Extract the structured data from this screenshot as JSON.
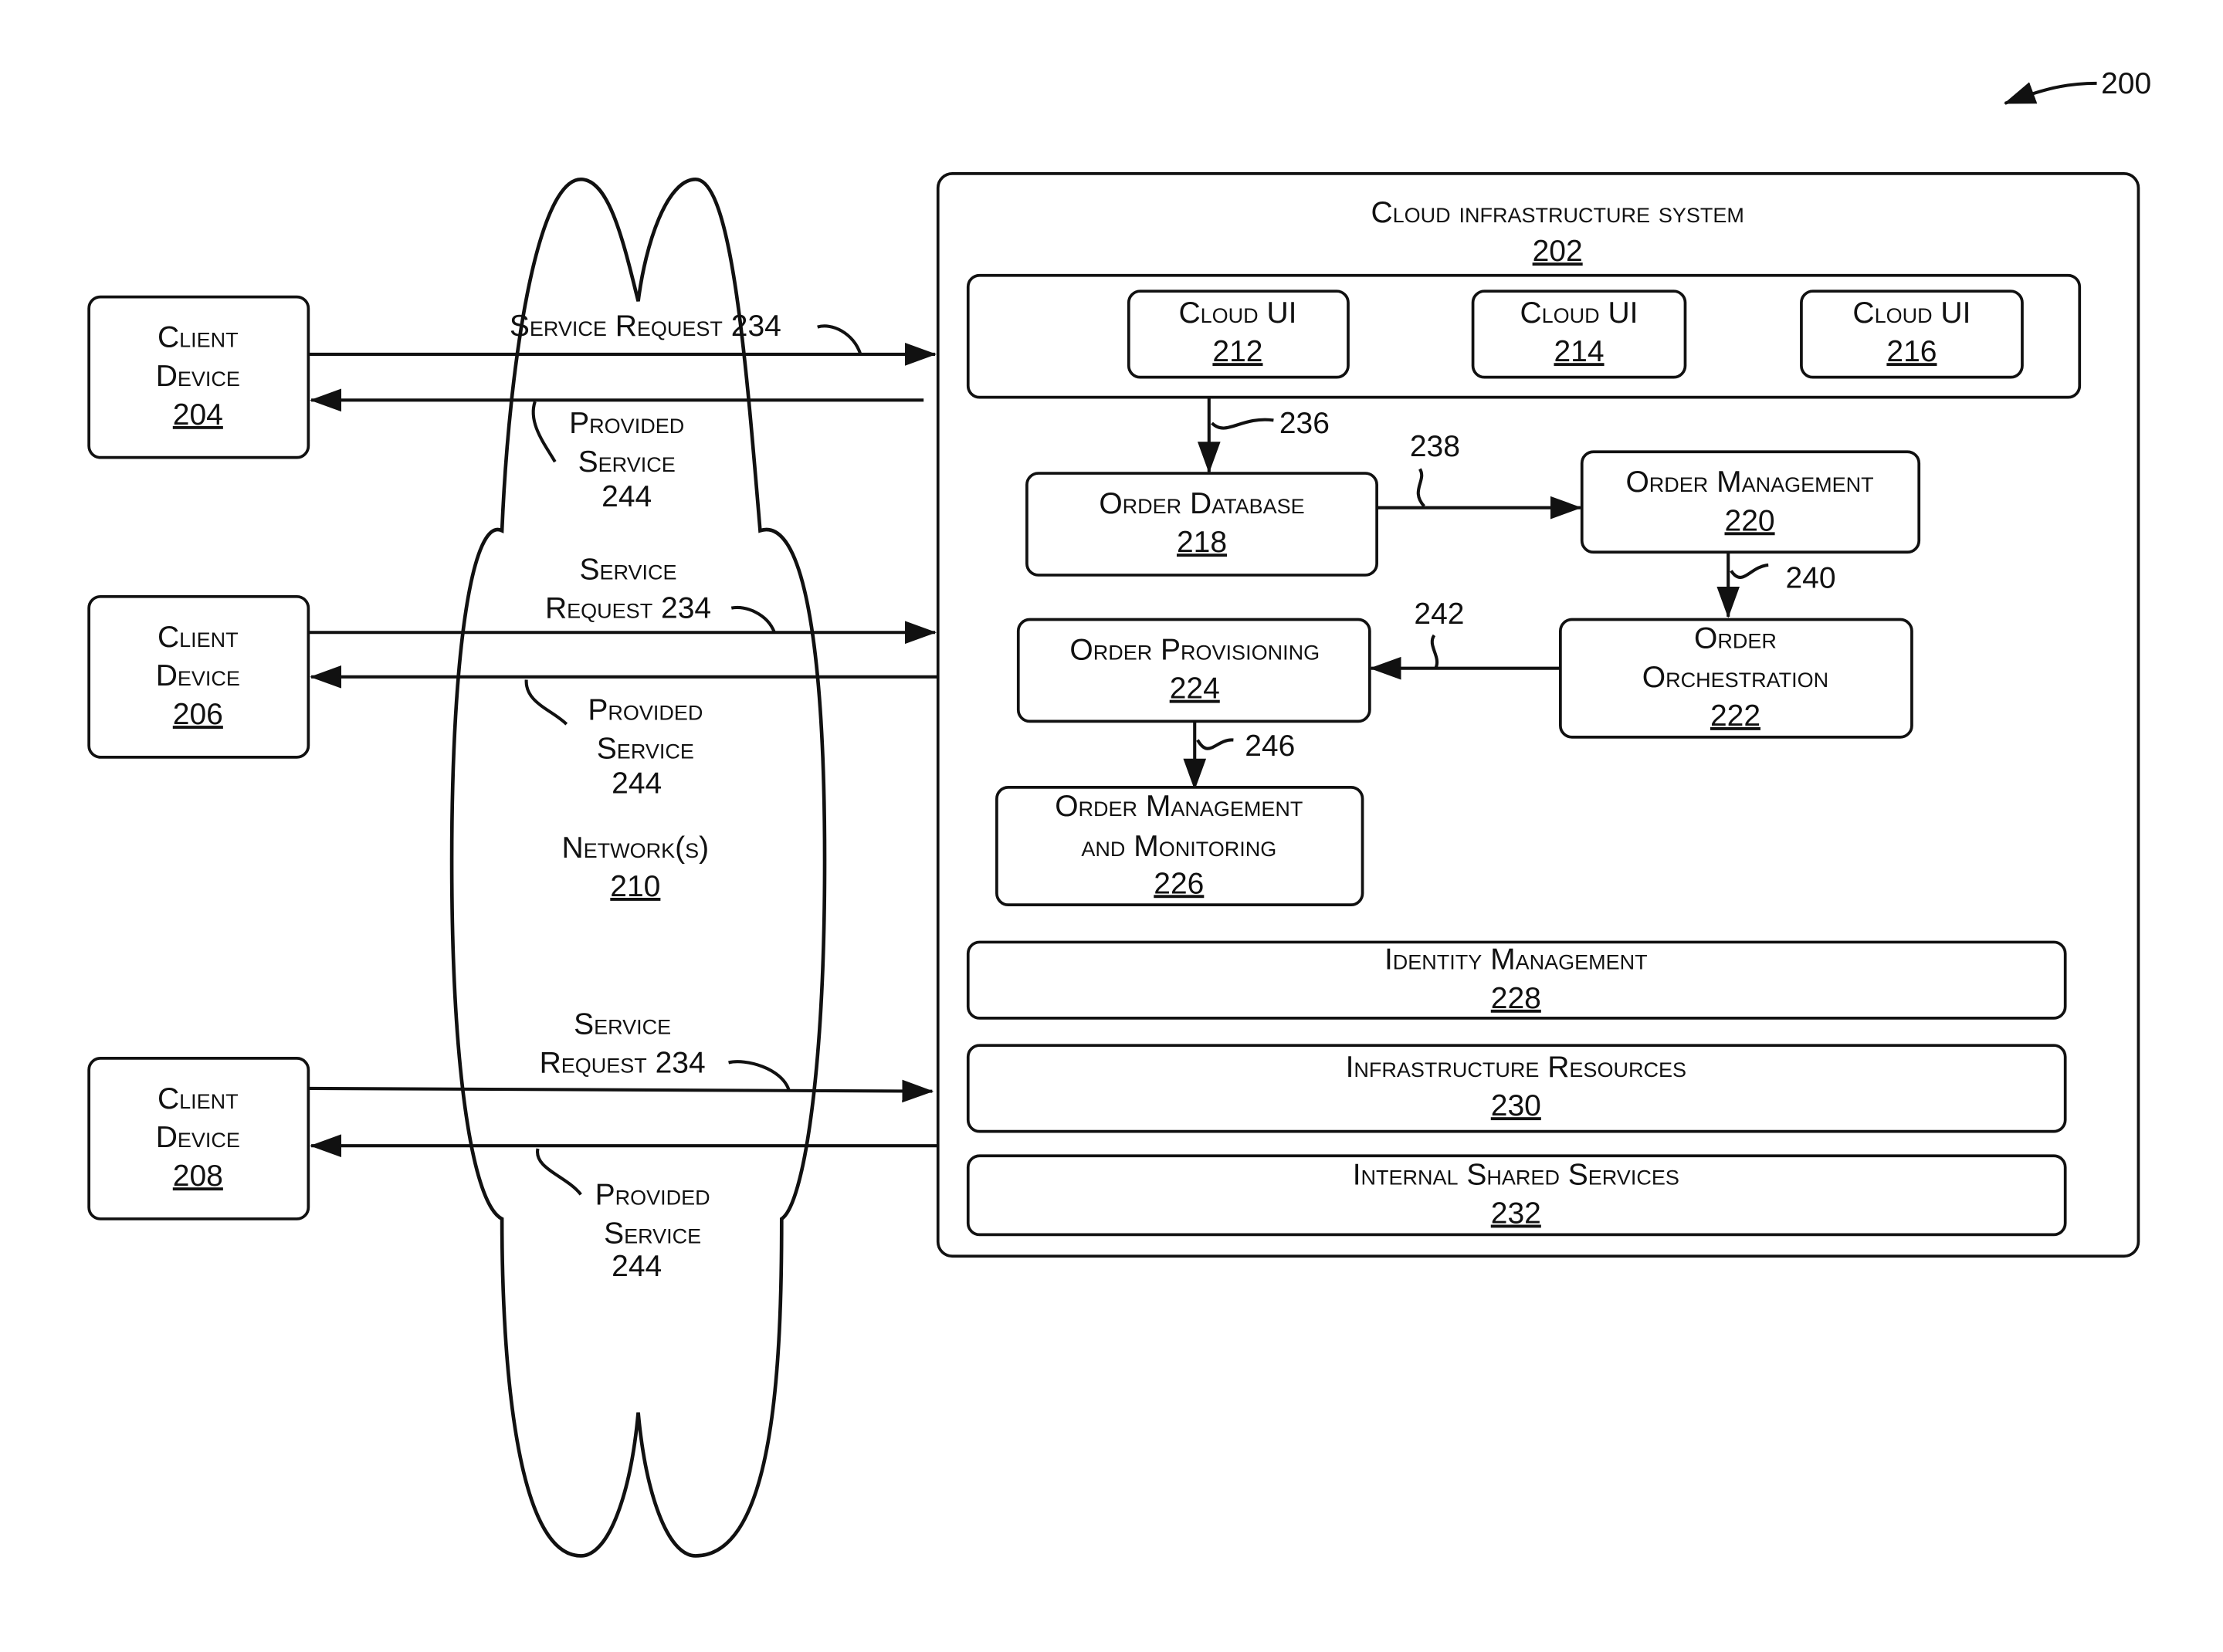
{
  "figure_ref": "200",
  "clients": [
    {
      "title1": "Client",
      "title2": "Device",
      "num": "204"
    },
    {
      "title1": "Client",
      "title2": "Device",
      "num": "206"
    },
    {
      "title1": "Client",
      "title2": "Device",
      "num": "208"
    }
  ],
  "network": {
    "label": "Network(s)",
    "num": "210"
  },
  "flows": [
    {
      "request": "Service Request 234",
      "provided1": "Provided",
      "provided2": "Service",
      "provided3": "244"
    },
    {
      "request1": "Service",
      "request2": "Request 234",
      "provided1": "Provided",
      "provided2": "Service",
      "provided3": "244"
    },
    {
      "request1": "Service",
      "request2": "Request 234",
      "provided1": "Provided",
      "provided2": "Service",
      "provided3": "244"
    }
  ],
  "system": {
    "title": "Cloud infrastructure system",
    "num": "202"
  },
  "cloud_uis": [
    {
      "label": "Cloud UI",
      "num": "212"
    },
    {
      "label": "Cloud UI",
      "num": "214"
    },
    {
      "label": "Cloud UI",
      "num": "216"
    }
  ],
  "modules": {
    "order_database": {
      "label": "Order Database",
      "num": "218"
    },
    "order_management": {
      "label": "Order Management",
      "num": "220"
    },
    "order_orchestration": {
      "label1": "Order",
      "label2": "Orchestration",
      "num": "222"
    },
    "order_provisioning": {
      "label": "Order Provisioning",
      "num": "224"
    },
    "order_mgmt_monitoring": {
      "label1": "Order Management",
      "label2": "and Monitoring",
      "num": "226"
    },
    "identity_management": {
      "label": "Identity Management",
      "num": "228"
    },
    "infrastructure_resources": {
      "label": "Infrastructure Resources",
      "num": "230"
    },
    "internal_shared_services": {
      "label": "Internal Shared Services",
      "num": "232"
    }
  },
  "arrow_refs": {
    "a236": "236",
    "a238": "238",
    "a240": "240",
    "a242": "242",
    "a246": "246"
  }
}
